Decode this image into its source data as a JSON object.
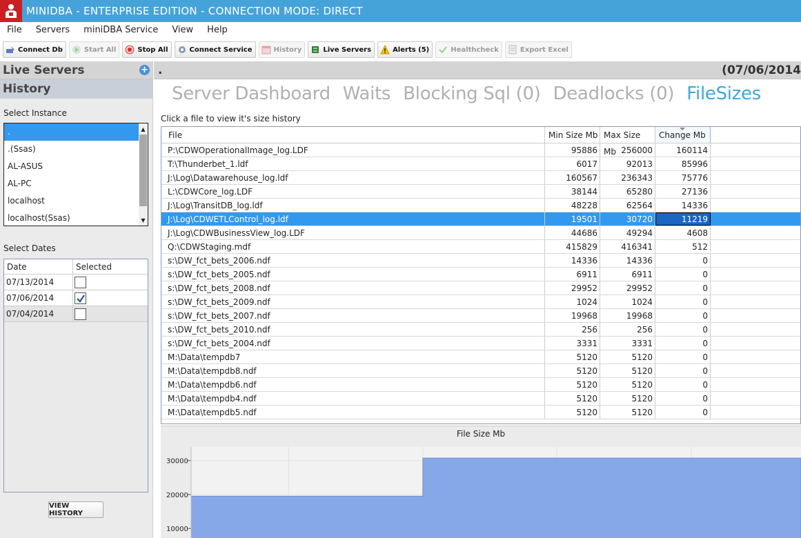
{
  "window": {
    "title": "MINIDBA - ENTERPRISE EDITION - CONNECTION MODE: DIRECT"
  },
  "menu": [
    "File",
    "Servers",
    "miniDBA Service",
    "View",
    "Help"
  ],
  "toolbar": {
    "connect_db": "Connect Db",
    "start_all": "Start All",
    "stop_all": "Stop All",
    "connect_service": "Connect Service",
    "history": "History",
    "live_servers": "Live Servers",
    "alerts": "Alerts (5)",
    "healthcheck": "Healthcheck",
    "export_excel": "Export Excel"
  },
  "left": {
    "live_servers_header": "Live Servers",
    "history_header": "History",
    "select_instance_label": "Select Instance",
    "instances": [
      ".",
      ".(Ssas)",
      "AL-ASUS",
      "AL-PC",
      "localhost",
      "localhost(Ssas)"
    ],
    "select_dates_label": "Select Dates",
    "dates_columns": [
      "Date",
      "Selected"
    ],
    "dates": [
      {
        "date": "07/13/2014",
        "selected": false
      },
      {
        "date": "07/06/2014",
        "selected": true
      },
      {
        "date": "07/04/2014",
        "selected": false
      }
    ],
    "view_history_button": "VIEW HISTORY"
  },
  "right": {
    "header_left": ".",
    "header_date": "(07/06/2014",
    "tabs": [
      "Server Dashboard",
      "Waits",
      "Blocking Sql (0)",
      "Deadlocks (0)",
      "FileSizes"
    ],
    "active_tab": "FileSizes",
    "hint": "Click a file to view it's size history",
    "columns": [
      "File",
      "Min Size Mb",
      "Max Size Mb",
      "Change Mb"
    ],
    "rows": [
      [
        "P:\\CDWOperationalImage_log.LDF",
        "95886",
        "256000",
        "160114"
      ],
      [
        "T:\\Thunderbet_1.ldf",
        "6017",
        "92013",
        "85996"
      ],
      [
        "J:\\Log\\Datawarehouse_log.ldf",
        "160567",
        "236343",
        "75776"
      ],
      [
        "L:\\CDWCore_log.LDF",
        "38144",
        "65280",
        "27136"
      ],
      [
        "J:\\Log\\TransitDB_log.ldf",
        "48228",
        "62564",
        "14336"
      ],
      [
        "J:\\Log\\CDWETLControl_log.ldf",
        "19501",
        "30720",
        "11219"
      ],
      [
        "J:\\Log\\CDWBusinessView_log.LDF",
        "44686",
        "49294",
        "4608"
      ],
      [
        "Q:\\CDWStaging.mdf",
        "415829",
        "416341",
        "512"
      ],
      [
        "s:\\DW_fct_bets_2006.ndf",
        "14336",
        "14336",
        "0"
      ],
      [
        "s:\\DW_fct_bets_2005.ndf",
        "6911",
        "6911",
        "0"
      ],
      [
        "s:\\DW_fct_bets_2008.ndf",
        "29952",
        "29952",
        "0"
      ],
      [
        "s:\\DW_fct_bets_2009.ndf",
        "1024",
        "1024",
        "0"
      ],
      [
        "s:\\DW_fct_bets_2007.ndf",
        "19968",
        "19968",
        "0"
      ],
      [
        "s:\\DW_fct_bets_2010.ndf",
        "256",
        "256",
        "0"
      ],
      [
        "s:\\DW_fct_bets_2004.ndf",
        "3331",
        "3331",
        "0"
      ],
      [
        "M:\\Data\\tempdb7",
        "5120",
        "5120",
        "0"
      ],
      [
        "M:\\Data\\tempdb8.ndf",
        "5120",
        "5120",
        "0"
      ],
      [
        "M:\\Data\\tempdb6.ndf",
        "5120",
        "5120",
        "0"
      ],
      [
        "M:\\Data\\tempdb4.ndf",
        "5120",
        "5120",
        "0"
      ],
      [
        "M:\\Data\\tempdb5.ndf",
        "5120",
        "5120",
        "0"
      ]
    ],
    "selected_row": 5
  },
  "chart_data": {
    "type": "area",
    "title": "File Size Mb",
    "yticks": [
      "30000",
      "20000",
      "10000"
    ],
    "ylim_visible": [
      7000,
      34000
    ],
    "series": [
      {
        "x": [
          0,
          0.38,
          0.38,
          1
        ],
        "values": [
          19501,
          19501,
          30720,
          30720
        ]
      }
    ],
    "color": "#86a8e8"
  }
}
